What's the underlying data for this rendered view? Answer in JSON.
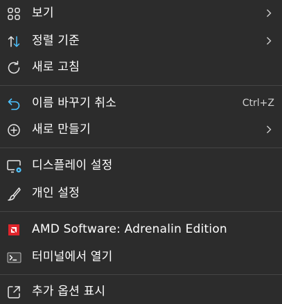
{
  "menu": {
    "items": [
      {
        "label": "보기",
        "icon": "grid-view-icon",
        "submenu": true
      },
      {
        "label": "정렬 기준",
        "icon": "sort-arrows-icon",
        "submenu": true
      },
      {
        "label": "새로 고침",
        "icon": "refresh-icon"
      },
      {
        "label": "이름 바꾸기 취소",
        "icon": "undo-icon",
        "shortcut": "Ctrl+Z"
      },
      {
        "label": "새로 만들기",
        "icon": "new-plus-icon",
        "submenu": true
      },
      {
        "label": "디스플레이 설정",
        "icon": "display-settings-icon"
      },
      {
        "label": "개인 설정",
        "icon": "brush-icon"
      },
      {
        "label": "AMD Software: Adrenalin Edition",
        "icon": "amd-logo-icon"
      },
      {
        "label": "터미널에서 열기",
        "icon": "terminal-icon"
      },
      {
        "label": "추가 옵션 표시",
        "icon": "show-more-options-icon"
      }
    ]
  },
  "colors": {
    "background": "#2c2c2c",
    "divider": "#454545",
    "text": "#ffffff",
    "icon": "#e6e6e6",
    "accent_blue": "#4cc2ff",
    "amd_red": "#e0242b"
  }
}
